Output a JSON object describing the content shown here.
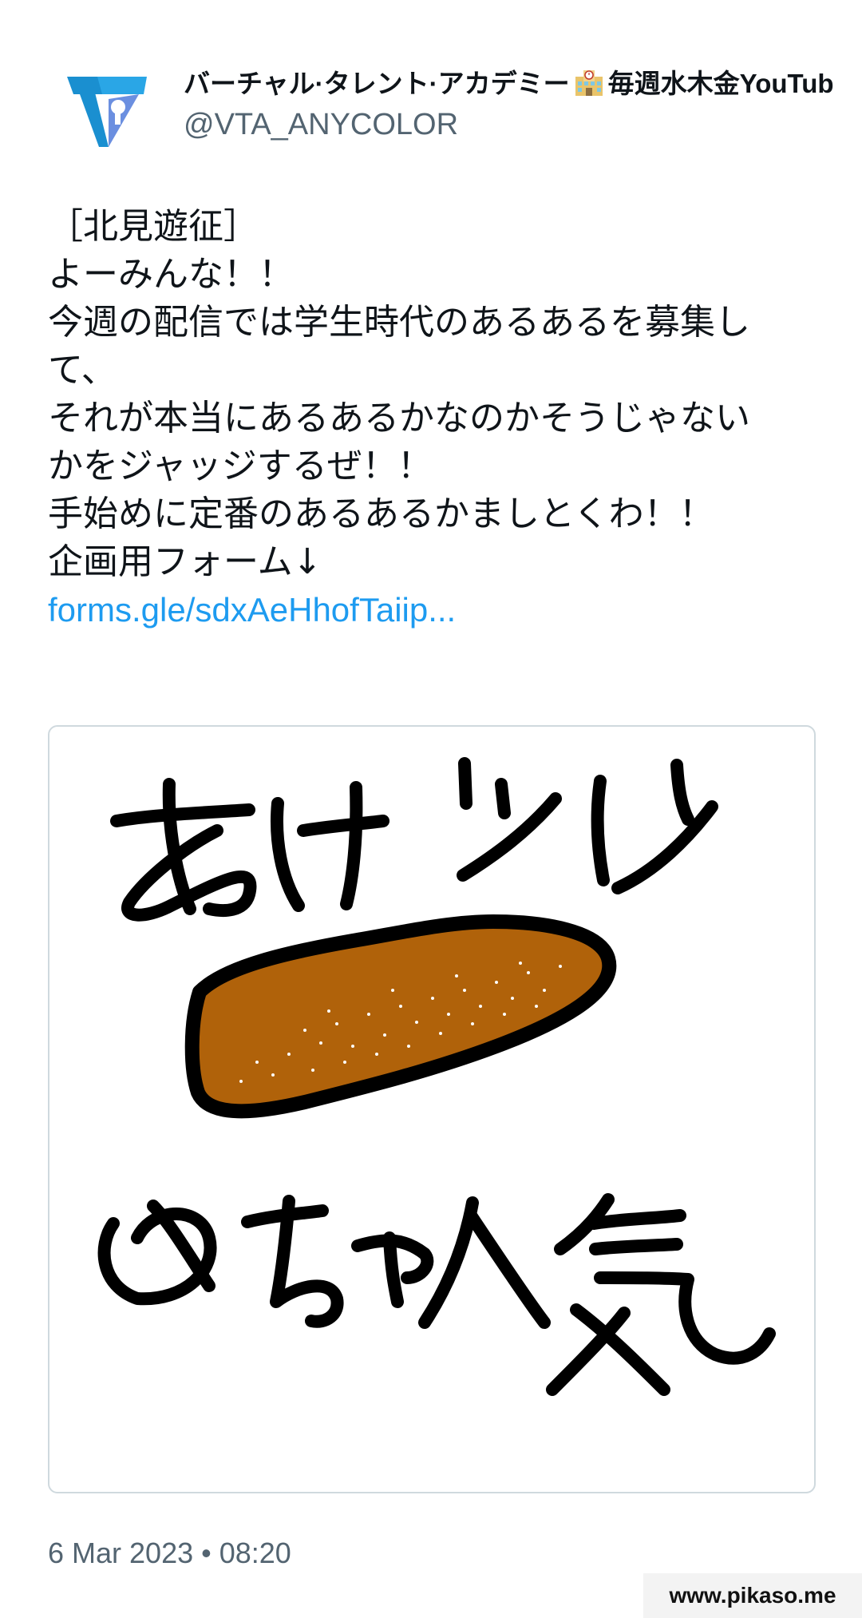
{
  "author": {
    "display_name_part1": "バーチャル·タレント·アカデミー",
    "display_name_part2": "毎週水木金YouTub",
    "handle": "@VTA_ANYCOLOR",
    "emoji_icon": "school-emoji-icon",
    "logo_icon": "vta-logo-icon",
    "brand_colors": [
      "#1a8fd0",
      "#6b8fe0"
    ]
  },
  "tweet": {
    "lines": [
      "［北見遊征］",
      "よーみんな！！",
      "今週の配信では学生時代のあるあるを募集し",
      "て、",
      "それが本当にあるあるかなのかそうじゃない",
      "かをジャッジするぜ！！",
      "手始めに定番のあるあるかましとくわ！！",
      "",
      "企画用フォーム↓"
    ],
    "link": "forms.gle/sdxAeHhofTaiip...",
    "link_color": "#1d9bf0"
  },
  "media": {
    "image_icon": "fried-bread-drawing",
    "handwritten_top": "あげパン",
    "handwritten_bottom": "めちゃ人気",
    "bread_color": "#b0620a"
  },
  "timestamp": "6 Mar 2023 • 08:20",
  "watermark": "www.pikaso.me"
}
